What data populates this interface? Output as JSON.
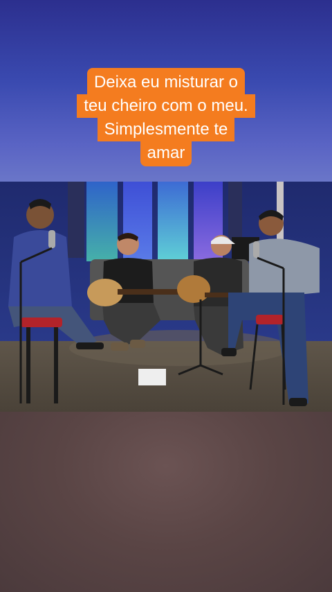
{
  "caption": {
    "lines": [
      "Deixa eu misturar o",
      "teu cheiro com o meu.",
      "Simplesmente te",
      "amar"
    ]
  },
  "colors": {
    "caption_background": "#f47c1f",
    "caption_text": "#ffffff",
    "top_background": "#3a4ab0",
    "bottom_background": "#5a4545"
  },
  "video": {
    "scene": "four-musicians-acoustic-studio-session",
    "icon": "video-frame-icon"
  }
}
